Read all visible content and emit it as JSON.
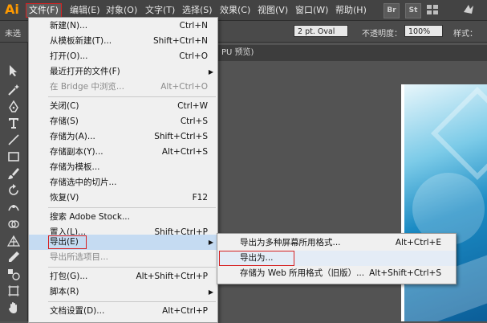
{
  "app": {
    "logo": "Ai"
  },
  "menubar": {
    "items": [
      "文件(F)",
      "编辑(E)",
      "对象(O)",
      "文字(T)",
      "选择(S)",
      "效果(C)",
      "视图(V)",
      "窗口(W)",
      "帮助(H)"
    ],
    "right_buttons": [
      "Br",
      "St"
    ]
  },
  "controlbar": {
    "left_text": "未选",
    "stroke_value": "2 pt. Oval",
    "opacity_label": "不透明度：",
    "opacity_value": "100%",
    "style_label": "样式："
  },
  "document": {
    "tab_label": "PU 预览)"
  },
  "file_menu": {
    "items": [
      {
        "label": "新建(N)...",
        "shortcut": "Ctrl+N"
      },
      {
        "label": "从模板新建(T)...",
        "shortcut": "Shift+Ctrl+N"
      },
      {
        "label": "打开(O)...",
        "shortcut": "Ctrl+O"
      },
      {
        "label": "最近打开的文件(F)",
        "shortcut": ""
      },
      {
        "label": "在 Bridge 中浏览...",
        "shortcut": "Alt+Ctrl+O"
      },
      {
        "label": "关闭(C)",
        "shortcut": "Ctrl+W"
      },
      {
        "label": "存储(S)",
        "shortcut": "Ctrl+S"
      },
      {
        "label": "存储为(A)...",
        "shortcut": "Shift+Ctrl+S"
      },
      {
        "label": "存储副本(Y)...",
        "shortcut": "Alt+Ctrl+S"
      },
      {
        "label": "存储为模板...",
        "shortcut": ""
      },
      {
        "label": "存储选中的切片...",
        "shortcut": ""
      },
      {
        "label": "恢复(V)",
        "shortcut": "F12"
      },
      {
        "label": "搜索 Adobe Stock...",
        "shortcut": ""
      },
      {
        "label": "置入(L)...",
        "shortcut": "Shift+Ctrl+P"
      },
      {
        "label": "导出(E)",
        "shortcut": ""
      },
      {
        "label": "导出所选项目...",
        "shortcut": ""
      },
      {
        "label": "打包(G)...",
        "shortcut": "Alt+Shift+Ctrl+P"
      },
      {
        "label": "脚本(R)",
        "shortcut": ""
      },
      {
        "label": "文档设置(D)...",
        "shortcut": "Alt+Ctrl+P"
      }
    ]
  },
  "export_submenu": {
    "items": [
      {
        "label": "导出为多种屏幕所用格式...",
        "shortcut": "Alt+Ctrl+E"
      },
      {
        "label": "导出为...",
        "shortcut": ""
      },
      {
        "label": "存储为 Web 所用格式（旧版）...",
        "shortcut": "Alt+Shift+Ctrl+S"
      }
    ]
  },
  "colors": {
    "accent_highlight": "#d62121",
    "menu_hover": "#c5dbf2",
    "logo": "#ff9a00"
  }
}
